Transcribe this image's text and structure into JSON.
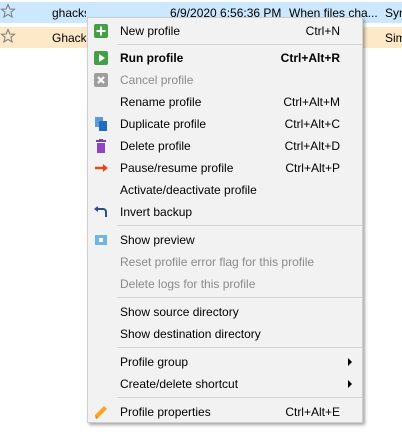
{
  "rows": [
    {
      "name": "ghacks synchronize",
      "date": "6/9/2020 6:56:36 PM",
      "condition": "When files cha...",
      "type": "Syn"
    },
    {
      "name": "Ghacks",
      "date": "",
      "condition": "",
      "type": "Sim"
    }
  ],
  "colors": {
    "row_selected": "#cce8ff",
    "row_highlight": "#fde8c8",
    "menu_background": "#f2f2f2",
    "disabled_text": "#8a8a8a"
  },
  "menu": {
    "items": [
      {
        "label": "New profile",
        "shortcut": "Ctrl+N",
        "icon": "green-plus-icon"
      },
      {
        "label": "Run profile",
        "shortcut": "Ctrl+Alt+R",
        "icon": "green-play-icon",
        "bold": true
      },
      {
        "label": "Cancel profile",
        "shortcut": "",
        "icon": "gray-cancel-icon",
        "disabled": true
      },
      {
        "label": "Rename profile",
        "shortcut": "Ctrl+Alt+M",
        "icon": ""
      },
      {
        "label": "Duplicate profile",
        "shortcut": "Ctrl+Alt+C",
        "icon": "duplicate-icon"
      },
      {
        "label": "Delete profile",
        "shortcut": "Ctrl+Alt+D",
        "icon": "trash-icon"
      },
      {
        "label": "Pause/resume profile",
        "shortcut": "Ctrl+Alt+P",
        "icon": "pause-resume-icon"
      },
      {
        "label": "Activate/deactivate profile",
        "shortcut": "",
        "icon": ""
      },
      {
        "label": "Invert backup",
        "shortcut": "",
        "icon": "invert-arrow-icon"
      },
      {
        "label": "Show preview",
        "shortcut": "",
        "icon": "preview-icon"
      },
      {
        "label": "Reset profile error flag for this profile",
        "shortcut": "",
        "icon": "",
        "disabled": true
      },
      {
        "label": "Delete logs for this profile",
        "shortcut": "",
        "icon": "",
        "disabled": true
      },
      {
        "label": "Show source directory",
        "shortcut": "",
        "icon": ""
      },
      {
        "label": "Show destination directory",
        "shortcut": "",
        "icon": ""
      },
      {
        "label": "Profile group",
        "shortcut": "",
        "icon": "",
        "submenu": true
      },
      {
        "label": "Create/delete shortcut",
        "shortcut": "",
        "icon": "",
        "submenu": true
      },
      {
        "label": "Profile properties",
        "shortcut": "Ctrl+Alt+E",
        "icon": "pencil-icon"
      }
    ]
  }
}
